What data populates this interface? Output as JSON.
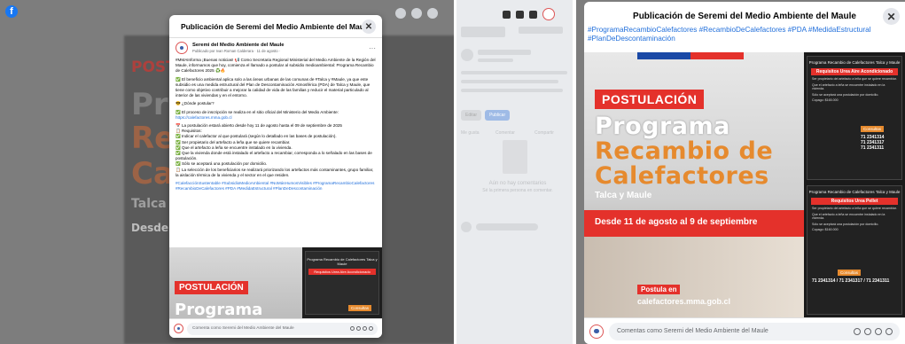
{
  "colors": {
    "fb_blue": "#1877f2",
    "link": "#216fdb",
    "red": "#e4312b",
    "orange": "#e68a2e"
  },
  "background": {
    "postul": "POST",
    "prog": "Pr",
    "recamb": "Re",
    "calef": "Cal",
    "talca": "Talca y",
    "desde": "Desde 11"
  },
  "modal": {
    "title": "Publicación de Seremi del Medio Ambiente del Maule",
    "close": "✕",
    "page_name": "Seremi del Medio Ambiente del Maule",
    "posted_by": "Publicado por Ivan Roman Calderara · 11 de agosto · ",
    "more": "···",
    "paragraphs": [
      "#MMAInforma ¡Buenas noticias! 📢 Como Secretaria Regional Ministerial del Medio Ambiente de la Región del Maule, informamos que hoy, comienza el llamado a postular al subsidio medioambiental: Programa Recambio de Calefactores 2025 ♻️🔥",
      "✅ El beneficio ambiental aplica solo a las áreas urbanas de las comunas de #Talca y #Maule, ya que este subsidio es una medida estructural del Plan de Descontaminación Atmosférica (PDA) de Talca y Maule, que tiene como objetivo contribuir a mejorar la calidad de vida de las familias y reducir el material particulado al interior de las viviendas y en el entorno.",
      "😎 ¿Dónde postular?",
      "✅ El proceso de inscripción se realiza en el sitio oficial del Ministerio del Medio Ambiente:",
      "📅 La postulación estará abierto desde hoy 11 de agosto hasta el 09 de septiembre de 2025",
      "📋 Requisitos:",
      "✅ Indicar el calefactor al que postulará (según lo detallado en las bases de postulación).",
      "✅ Ser propietario del artefacto a leña que se quiere recambiar.",
      "✅ Que el artefacto a leña se encuentre instalado en la vivienda.",
      "✅ Que la vivienda donde está instalado el artefacto a recambiar, corresponda a lo señalado en las bases de postulación.",
      "✅ Sólo se aceptará una postulación por domicilio.",
      "📋 La selección de los beneficiarios se realizará priorizando los artefactos más contaminantes, grupo familiar, la aislación térmica de la vivienda y el sector en el que residen."
    ],
    "url": "https://calefactores.mma.gob.cl",
    "hashtags": "#CalefacciónSustentable #SubsidioMedioAmbiental #NoMásHumosVisibles #ProgramaRecambioCalefactores #RecambioDeCalefactores #PDA #MedidaEstructural #PlanDeDescontaminación",
    "img_postulacion": "POSTULACIÓN",
    "img_programa": "Programa",
    "card_title": "Programa Recambio de Calefactores Talca y Maule",
    "card_req": "Requisitos Urea Aire Acondicionado",
    "card_consultas": "Consultas",
    "comment_placeholder": "Comenta como Seremi del Medio Ambiente del Maule"
  },
  "panel2": {
    "publicar": "Publicar",
    "editar": "Editar",
    "me_gusta": "Me gusta",
    "comentar": "Comentar",
    "compartir": "Compartir",
    "no_comments_title": "Aún no hay comentarios",
    "no_comments_sub": "Sé la primera persona en comentar."
  },
  "panel3": {
    "title": "Publicación de Seremi del Medio Ambiente del Maule",
    "close": "✕",
    "hashtags": "#ProgramaRecambioCalefactores #RecambioDeCalefactores #PDA #MedidaEstructural #PlanDeDescontaminación",
    "postulacion": "POSTULACIÓN",
    "programa": "Programa",
    "recambio": "Recambio de",
    "calefactores": "Calefactores",
    "talca": "Talca y Maule",
    "dates": "Desde 11 de agosto al 9 de septiembre",
    "postula_en": "Postula en",
    "web": "calefactores.mma.gob.cl",
    "card1_title": "Programa Recambio de Calefactores Talca y Maule",
    "card1_req": "Requisitos Urea Aire Acondicionado",
    "card1_items": [
      "Ser propietario del artefacto a leña que se quiere recambiar.",
      "Que el artefacto a leña se encuentre instalado en la vivienda.",
      "Sólo se aceptará una postulación por domicilio.",
      "Copago: $165.000"
    ],
    "card2_title": "Programa Recambio de Calefactores Talca y Maule",
    "card2_req": "Requisitos Urea Pellet",
    "card2_items": [
      "Ser propietario del artefacto a leña que se quiere recambiar.",
      "Que el artefacto a leña se encuentre instalado en la vivienda.",
      "Sólo se aceptará una postulación por domicilio.",
      "Copago: $160.000"
    ],
    "consultas": "Consultas",
    "phones": "71 2341314\n71 2341317\n71 2341311",
    "phones2": "71 2341314 / 71 2341317 / 71 2341311",
    "comment_placeholder": "Comentas como Seremi del Medio Ambiente del Maule"
  }
}
